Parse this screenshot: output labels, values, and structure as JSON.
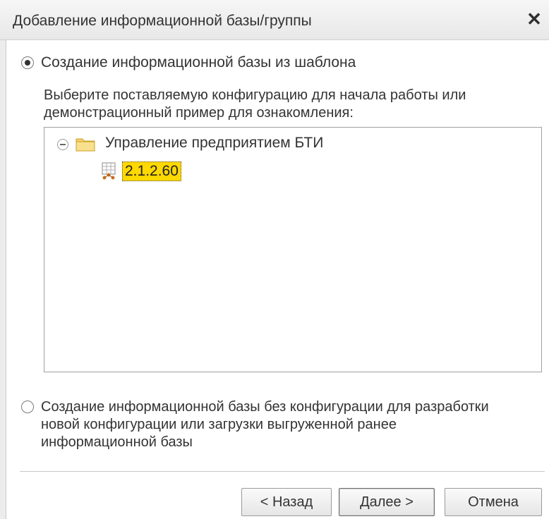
{
  "dialog": {
    "title": "Добавление информационной базы/группы"
  },
  "option_template": {
    "label": "Создание информационной базы из шаблона",
    "selected": true,
    "hint_line1": "Выберите поставляемую конфигурацию для начала работы или",
    "hint_line2": "демонстрационный пример для ознакомления:"
  },
  "tree": {
    "group": "Управление предприятием БТИ",
    "version": "2.1.2.60"
  },
  "option_empty": {
    "line1": "Создание информационной базы без конфигурации для разработки",
    "line2": "новой конфигурации или загрузки выгруженной ранее",
    "line3": "информационной базы",
    "selected": false
  },
  "buttons": {
    "back": "< Назад",
    "next": "Далее >",
    "cancel": "Отмена"
  },
  "colors": {
    "selection": "#ffd800",
    "folder": "#f2c94c"
  }
}
